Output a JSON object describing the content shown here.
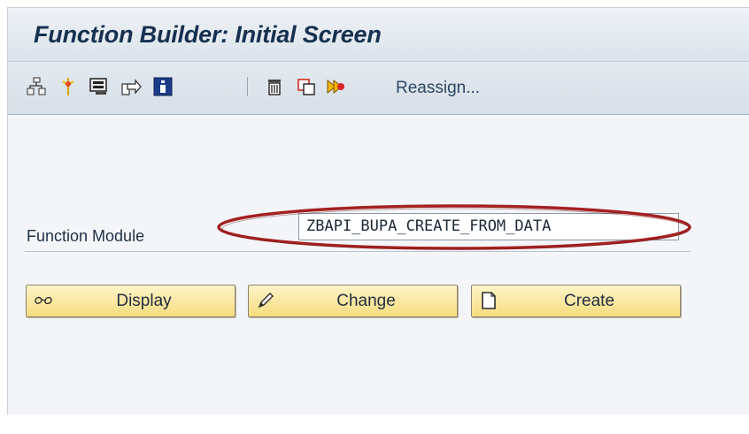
{
  "window": {
    "title": "Function Builder: Initial Screen"
  },
  "toolbar": {
    "icons": [
      "object-tree-icon",
      "where-used-icon",
      "test-icon",
      "copy-icon",
      "info-icon",
      "delete-icon",
      "copy-object-icon",
      "rename-icon"
    ],
    "reassign_label": "Reassign..."
  },
  "form": {
    "function_module_label": "Function Module",
    "function_module_value": "ZBAPI_BUPA_CREATE_FROM_DATA"
  },
  "buttons": {
    "display_label": "Display",
    "change_label": "Change",
    "create_label": "Create"
  },
  "colors": {
    "title_text": "#16304f",
    "highlight_ellipse": "#a32121",
    "button_fill": "#f7dc7e"
  }
}
